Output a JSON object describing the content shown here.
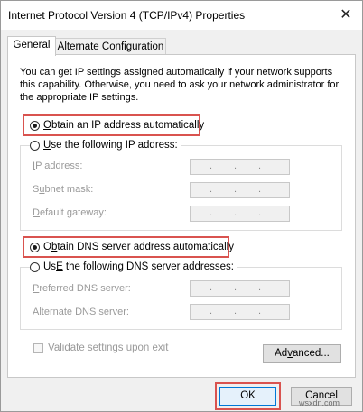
{
  "window": {
    "title": "Internet Protocol Version 4 (TCP/IPv4) Properties",
    "close_glyph": "✕"
  },
  "tabs": [
    {
      "label": "General",
      "active": true
    },
    {
      "label": "Alternate Configuration",
      "active": false
    }
  ],
  "description": "You can get IP settings assigned automatically if your network supports this capability. Otherwise, you need to ask your network administrator for the appropriate IP settings.",
  "ip_section": {
    "auto_option": {
      "label_key": "O",
      "label_rest": "btain an IP address automatically",
      "selected": true
    },
    "manual_option": {
      "label_key": "U",
      "label_rest": "se the following IP address:",
      "selected": false
    },
    "fields": [
      {
        "label_key": "I",
        "label_rest": "P address:"
      },
      {
        "label_key": "u",
        "label_pre": "S",
        "label_rest": "bnet mask:"
      },
      {
        "label_key": "D",
        "label_rest": "efault gateway:"
      }
    ]
  },
  "dns_section": {
    "auto_option": {
      "label_key": "b",
      "label_pre": "O",
      "label_rest": "tain DNS server address automatically",
      "selected": true
    },
    "manual_option": {
      "label_key": "E",
      "label_pre": "Us",
      "label_rest": " the following DNS server addresses:",
      "selected": false
    },
    "fields": [
      {
        "label_key": "P",
        "label_rest": "referred DNS server:"
      },
      {
        "label_key": "A",
        "label_rest": "lternate DNS server:"
      }
    ]
  },
  "validate": {
    "label_pre": "Va",
    "label_key": "l",
    "label_rest": "idate settings upon exit",
    "checked": false
  },
  "buttons": {
    "advanced": {
      "label_pre": "Ad",
      "label_key": "v",
      "label_rest": "anced..."
    },
    "ok": "OK",
    "cancel": "Cancel"
  },
  "ip_dot": ".",
  "watermark": "wsxdn.com",
  "colors": {
    "highlight_box": "#d9534f",
    "focus_button": "#0078d7"
  }
}
